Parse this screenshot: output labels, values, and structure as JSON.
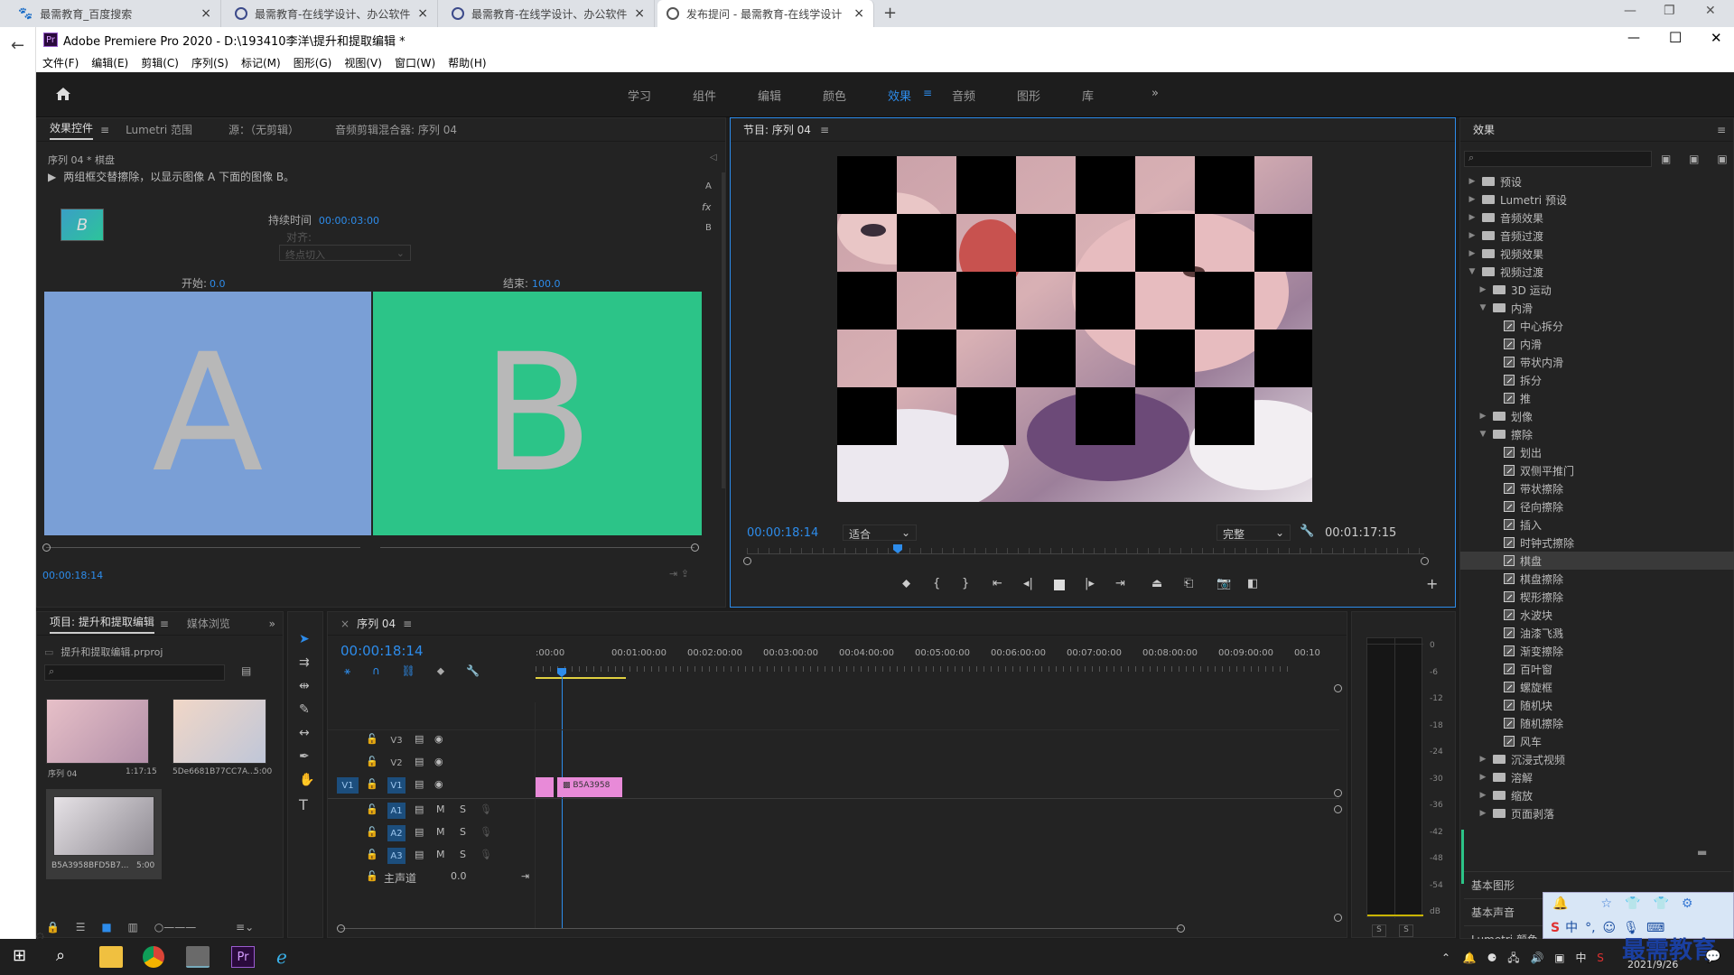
{
  "browser": {
    "tabs": [
      {
        "title": "最需教育_百度搜索"
      },
      {
        "title": "最需教育-在线学设计、办公软件"
      },
      {
        "title": "最需教育-在线学设计、办公软件"
      },
      {
        "title": "发布提问 - 最需教育-在线学设计"
      }
    ]
  },
  "app": {
    "title": "Adobe Premiere Pro 2020 - D:\\193410李洋\\提升和提取编辑 *",
    "menu": [
      "文件(F)",
      "编辑(E)",
      "剪辑(C)",
      "序列(S)",
      "标记(M)",
      "图形(G)",
      "视图(V)",
      "窗口(W)",
      "帮助(H)"
    ],
    "workspaces": [
      "学习",
      "组件",
      "编辑",
      "颜色",
      "效果",
      "音频",
      "图形",
      "库"
    ],
    "active_workspace": "效果"
  },
  "effect_controls": {
    "tabs": [
      "效果控件",
      "Lumetri 范围",
      "源：（无剪辑）",
      "音频剪辑混合器: 序列 04"
    ],
    "clip": "序列 04 * 棋盘",
    "description": "两组框交替擦除，以显示图像 A 下面的图像 B。",
    "duration_label": "持续时间",
    "duration_value": "00:00:03:00",
    "align_label": "对齐:",
    "align_value": "终点切入",
    "start_label": "开始:",
    "start_value": "0.0",
    "end_label": "结束:",
    "end_value": "100.0",
    "preview_a": "A",
    "preview_b": "B",
    "timecode": "00:00:18:14",
    "side_icons": [
      "A",
      "fx",
      "B"
    ]
  },
  "program": {
    "title": "节目: 序列 04",
    "timecode": "00:00:18:14",
    "fit": "适合",
    "quality": "完整",
    "duration": "00:01:17:15"
  },
  "effects": {
    "title": "效果",
    "tree": [
      {
        "label": "预设",
        "type": "folder",
        "level": 0,
        "open": false
      },
      {
        "label": "Lumetri 预设",
        "type": "folder",
        "level": 0,
        "open": false
      },
      {
        "label": "音频效果",
        "type": "folder",
        "level": 0,
        "open": false
      },
      {
        "label": "音频过渡",
        "type": "folder",
        "level": 0,
        "open": false
      },
      {
        "label": "视频效果",
        "type": "folder",
        "level": 0,
        "open": false
      },
      {
        "label": "视频过渡",
        "type": "folder",
        "level": 0,
        "open": true
      },
      {
        "label": "3D 运动",
        "type": "folder",
        "level": 1,
        "open": false
      },
      {
        "label": "内滑",
        "type": "folder",
        "level": 1,
        "open": true
      },
      {
        "label": "中心拆分",
        "type": "fx",
        "level": 2
      },
      {
        "label": "内滑",
        "type": "fx",
        "level": 2
      },
      {
        "label": "带状内滑",
        "type": "fx",
        "level": 2
      },
      {
        "label": "拆分",
        "type": "fx",
        "level": 2
      },
      {
        "label": "推",
        "type": "fx",
        "level": 2
      },
      {
        "label": "划像",
        "type": "folder",
        "level": 1,
        "open": false
      },
      {
        "label": "擦除",
        "type": "folder",
        "level": 1,
        "open": true
      },
      {
        "label": "划出",
        "type": "fx",
        "level": 2
      },
      {
        "label": "双侧平推门",
        "type": "fx",
        "level": 2
      },
      {
        "label": "带状擦除",
        "type": "fx",
        "level": 2
      },
      {
        "label": "径向擦除",
        "type": "fx",
        "level": 2
      },
      {
        "label": "插入",
        "type": "fx",
        "level": 2
      },
      {
        "label": "时钟式擦除",
        "type": "fx",
        "level": 2
      },
      {
        "label": "棋盘",
        "type": "fx",
        "level": 2,
        "selected": true
      },
      {
        "label": "棋盘擦除",
        "type": "fx",
        "level": 2
      },
      {
        "label": "楔形擦除",
        "type": "fx",
        "level": 2
      },
      {
        "label": "水波块",
        "type": "fx",
        "level": 2
      },
      {
        "label": "油漆飞溅",
        "type": "fx",
        "level": 2
      },
      {
        "label": "渐变擦除",
        "type": "fx",
        "level": 2
      },
      {
        "label": "百叶窗",
        "type": "fx",
        "level": 2
      },
      {
        "label": "螺旋框",
        "type": "fx",
        "level": 2
      },
      {
        "label": "随机块",
        "type": "fx",
        "level": 2
      },
      {
        "label": "随机擦除",
        "type": "fx",
        "level": 2
      },
      {
        "label": "风车",
        "type": "fx",
        "level": 2
      },
      {
        "label": "沉浸式视频",
        "type": "folder",
        "level": 1,
        "open": false
      },
      {
        "label": "溶解",
        "type": "folder",
        "level": 1,
        "open": false
      },
      {
        "label": "缩放",
        "type": "folder",
        "level": 1,
        "open": false
      },
      {
        "label": "页面剥落",
        "type": "folder",
        "level": 1,
        "open": false
      }
    ],
    "bottom_sections": [
      "基本图形",
      "基本声音",
      "Lumetri 颜色"
    ]
  },
  "project": {
    "tabs": [
      "项目: 提升和提取编辑",
      "媒体浏览"
    ],
    "file": "提升和提取编辑.prproj",
    "items": [
      {
        "name": "序列 04",
        "duration": "1:17:15"
      },
      {
        "name": "5De6681B77CC7A...",
        "duration": "5:00"
      },
      {
        "name": "B5A3958BFD5B7...",
        "duration": "5:00"
      }
    ]
  },
  "timeline": {
    "title": "序列 04",
    "timecode": "00:00:18:14",
    "ruler": [
      ":00:00",
      "00:01:00:00",
      "00:02:00:00",
      "00:03:00:00",
      "00:04:00:00",
      "00:05:00:00",
      "00:06:00:00",
      "00:07:00:00",
      "00:08:00:00",
      "00:09:00:00",
      "00:10"
    ],
    "video_tracks": [
      "V3",
      "V2",
      "V1"
    ],
    "audio_tracks": [
      "A1",
      "A2",
      "A3"
    ],
    "source_patch": "V1",
    "master": "主声道",
    "master_value": "0.0",
    "clip_name": "B5A3958",
    "mute": "M",
    "solo": "S"
  },
  "meter": {
    "scale": [
      "0",
      "-6",
      "-12",
      "-18",
      "-24",
      "-30",
      "-36",
      "-42",
      "-48",
      "-54",
      "dB"
    ],
    "solo_labels": [
      "S",
      "S"
    ]
  },
  "ime": {
    "text": "中"
  },
  "taskbar": {
    "date": "2021/9/26",
    "watermark": "最需教育"
  }
}
